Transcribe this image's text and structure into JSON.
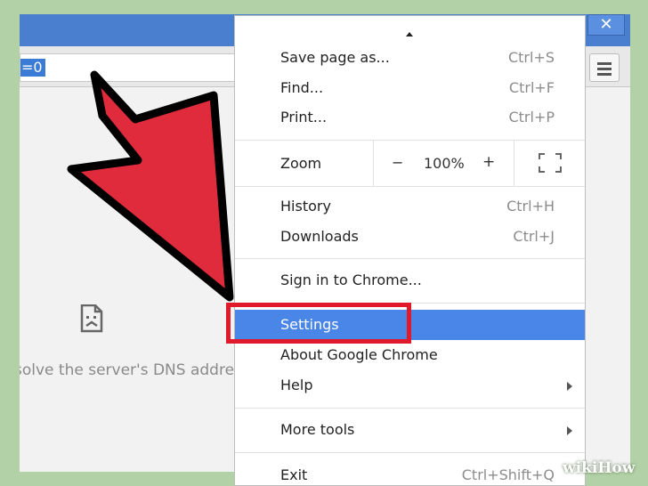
{
  "window": {
    "close_label": "✕"
  },
  "toolbar": {
    "omnibox_text": "=0"
  },
  "content": {
    "error_text": "solve the server's DNS addre"
  },
  "menu": {
    "items_top": [
      {
        "label": "Save page as...",
        "shortcut": "Ctrl+S"
      },
      {
        "label": "Find...",
        "shortcut": "Ctrl+F"
      },
      {
        "label": "Print...",
        "shortcut": "Ctrl+P"
      }
    ],
    "zoom": {
      "label": "Zoom",
      "minus": "−",
      "value": "100%",
      "plus": "+"
    },
    "items_history": [
      {
        "label": "History",
        "shortcut": "Ctrl+H"
      },
      {
        "label": "Downloads",
        "shortcut": "Ctrl+J"
      }
    ],
    "sign_in": {
      "label": "Sign in to Chrome..."
    },
    "settings": {
      "label": "Settings"
    },
    "about": {
      "label": "About Google Chrome"
    },
    "help": {
      "label": "Help"
    },
    "more_tools": {
      "label": "More tools"
    },
    "exit": {
      "label": "Exit",
      "shortcut": "Ctrl+Shift+Q"
    }
  },
  "colors": {
    "highlight": "#4a86e8",
    "callout": "#e0192b",
    "arrow": "#df2b3c"
  },
  "icons": {
    "close": "close-icon",
    "menu": "hamburger-menu-icon",
    "error": "sad-page-icon",
    "fullscreen": "fullscreen-icon",
    "submenu": "chevron-right-icon"
  },
  "watermark": "wikiHow"
}
